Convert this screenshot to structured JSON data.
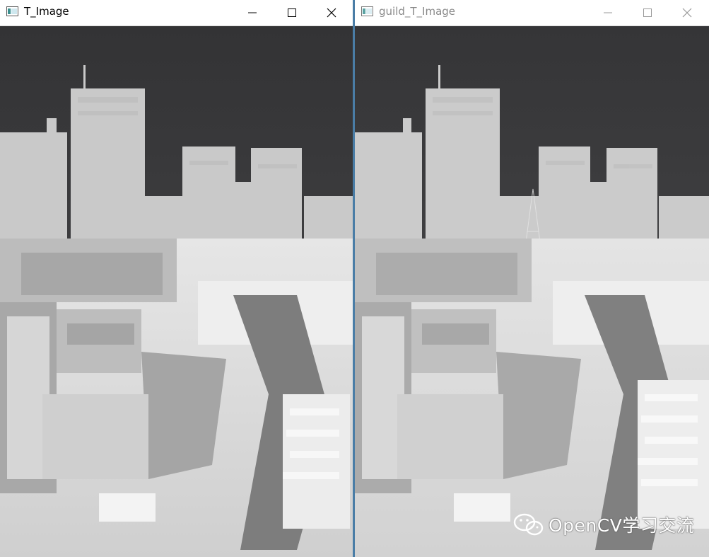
{
  "windows": [
    {
      "title": "T_Image",
      "active": true,
      "controls": {
        "minimize": "minimize-icon",
        "maximize": "maximize-icon",
        "close": "close-icon"
      }
    },
    {
      "title": "guild_T_Image",
      "active": false,
      "controls": {
        "minimize": "minimize-icon",
        "maximize": "maximize-icon",
        "close": "close-icon"
      }
    }
  ],
  "watermark": {
    "text": "OpenCV学习交流",
    "icon": "wechat-icon"
  },
  "colors": {
    "sky": "#3a3a3c",
    "buildings": "#d8d8d8",
    "highlight": "#f2f2f2",
    "inactive_title": "#8a8a8a",
    "divider": "#4a7da6"
  }
}
